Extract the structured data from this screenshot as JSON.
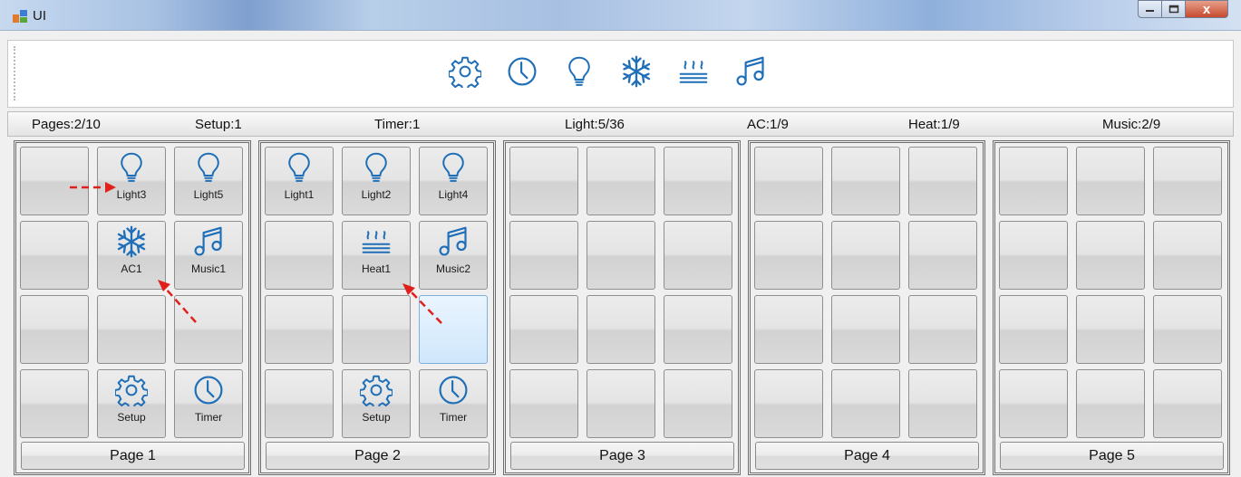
{
  "window": {
    "title": "UI",
    "close_symbol": "x"
  },
  "toolbar": {
    "icons": [
      "gear-icon",
      "clock-icon",
      "lightbulb-icon",
      "snowflake-icon",
      "heat-icon",
      "music-note-icon"
    ]
  },
  "info": {
    "pages": "Pages:2/10",
    "setup": "Setup:1",
    "timer": "Timer:1",
    "light": "Light:5/36",
    "ac": "AC:1/9",
    "heat": "Heat:1/9",
    "music": "Music:2/9"
  },
  "pages": [
    {
      "label": "Page 1",
      "tiles": [
        {
          "icon": "",
          "label": ""
        },
        {
          "icon": "lightbulb-icon",
          "label": "Light3"
        },
        {
          "icon": "lightbulb-icon",
          "label": "Light5"
        },
        {
          "icon": "",
          "label": ""
        },
        {
          "icon": "snowflake-icon",
          "label": "AC1"
        },
        {
          "icon": "music-note-icon",
          "label": "Music1"
        },
        {
          "icon": "",
          "label": ""
        },
        {
          "icon": "",
          "label": ""
        },
        {
          "icon": "",
          "label": ""
        },
        {
          "icon": "",
          "label": ""
        },
        {
          "icon": "gear-icon",
          "label": "Setup"
        },
        {
          "icon": "clock-icon",
          "label": "Timer"
        }
      ]
    },
    {
      "label": "Page 2",
      "tiles": [
        {
          "icon": "lightbulb-icon",
          "label": "Light1"
        },
        {
          "icon": "lightbulb-icon",
          "label": "Light2"
        },
        {
          "icon": "lightbulb-icon",
          "label": "Light4"
        },
        {
          "icon": "",
          "label": ""
        },
        {
          "icon": "heat-icon",
          "label": "Heat1"
        },
        {
          "icon": "music-note-icon",
          "label": "Music2"
        },
        {
          "icon": "",
          "label": ""
        },
        {
          "icon": "",
          "label": ""
        },
        {
          "icon": "",
          "label": "",
          "selected": true
        },
        {
          "icon": "",
          "label": ""
        },
        {
          "icon": "gear-icon",
          "label": "Setup"
        },
        {
          "icon": "clock-icon",
          "label": "Timer"
        }
      ]
    },
    {
      "label": "Page 3",
      "tiles": [
        {
          "icon": "",
          "label": ""
        },
        {
          "icon": "",
          "label": ""
        },
        {
          "icon": "",
          "label": ""
        },
        {
          "icon": "",
          "label": ""
        },
        {
          "icon": "",
          "label": ""
        },
        {
          "icon": "",
          "label": ""
        },
        {
          "icon": "",
          "label": ""
        },
        {
          "icon": "",
          "label": ""
        },
        {
          "icon": "",
          "label": ""
        },
        {
          "icon": "",
          "label": ""
        },
        {
          "icon": "",
          "label": ""
        },
        {
          "icon": "",
          "label": ""
        }
      ]
    },
    {
      "label": "Page 4",
      "tiles": [
        {
          "icon": "",
          "label": ""
        },
        {
          "icon": "",
          "label": ""
        },
        {
          "icon": "",
          "label": ""
        },
        {
          "icon": "",
          "label": ""
        },
        {
          "icon": "",
          "label": ""
        },
        {
          "icon": "",
          "label": ""
        },
        {
          "icon": "",
          "label": ""
        },
        {
          "icon": "",
          "label": ""
        },
        {
          "icon": "",
          "label": ""
        },
        {
          "icon": "",
          "label": ""
        },
        {
          "icon": "",
          "label": ""
        },
        {
          "icon": "",
          "label": ""
        }
      ]
    },
    {
      "label": "Page 5",
      "tiles": [
        {
          "icon": "",
          "label": ""
        },
        {
          "icon": "",
          "label": ""
        },
        {
          "icon": "",
          "label": ""
        },
        {
          "icon": "",
          "label": ""
        },
        {
          "icon": "",
          "label": ""
        },
        {
          "icon": "",
          "label": ""
        },
        {
          "icon": "",
          "label": ""
        },
        {
          "icon": "",
          "label": ""
        },
        {
          "icon": "",
          "label": ""
        },
        {
          "icon": "",
          "label": ""
        },
        {
          "icon": "",
          "label": ""
        },
        {
          "icon": "",
          "label": ""
        }
      ]
    }
  ],
  "colors": {
    "icon_blue": "#1f6fb8",
    "annotation_red": "#e0201c",
    "selected_tile": "#cfe7fb"
  }
}
